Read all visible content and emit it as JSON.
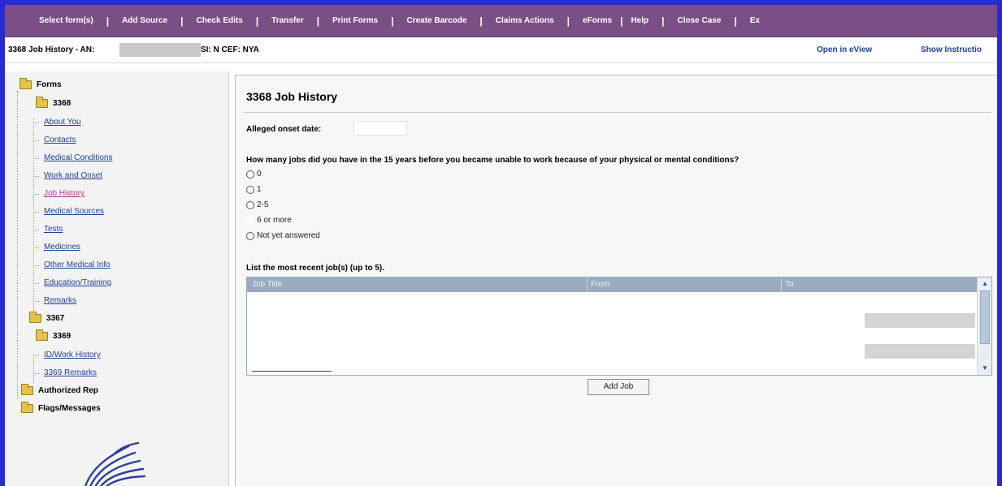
{
  "menu": {
    "items": [
      "Select form(s)",
      "Add Source",
      "Check Edits",
      "Transfer",
      "Print Forms",
      "Create Barcode",
      "Claims Actions",
      "eForms",
      "Help",
      "Close Case",
      "Ex"
    ],
    "separator": "|"
  },
  "header": {
    "title": "3368 Job History - AN:",
    "si": "SI: N  CEF: NYA",
    "open_eview": "Open in eView",
    "show_instructions": "Show Instructio"
  },
  "tree": {
    "forms": "Forms",
    "f3368": "3368",
    "f3368_items": [
      "About You",
      "Contacts",
      "Medical Conditions",
      "Work and Onset",
      "Job History",
      "Medical Sources",
      "Tests",
      "Medicines",
      "Other Medical Info",
      "Education/Training",
      "Remarks"
    ],
    "f3367": "3367",
    "f3369": "3369",
    "f3369_items": [
      "ID/Work History",
      "3369 Remarks"
    ],
    "authorized_rep": "Authorized Rep",
    "flags": "Flags/Messages"
  },
  "main": {
    "title": "3368 Job History",
    "onset_label": "Alleged onset date:",
    "onset_value": "",
    "question": "How many jobs did you have in the 15 years before you became unable to work because of your physical or mental conditions?",
    "options": [
      "0",
      "1",
      "2-5",
      "6 or more",
      "Not yet answered"
    ],
    "list_label": "List the most recent job(s) (up to 5).",
    "grid_columns": [
      "Job Title",
      "From",
      "To"
    ],
    "add_job": "Add Job"
  },
  "colors": {
    "menubar": "#7a4f86",
    "frame": "#2a2ad0",
    "link": "#1f3f9c",
    "active_link": "#c0368c",
    "grid_header": "#9aabbf"
  }
}
